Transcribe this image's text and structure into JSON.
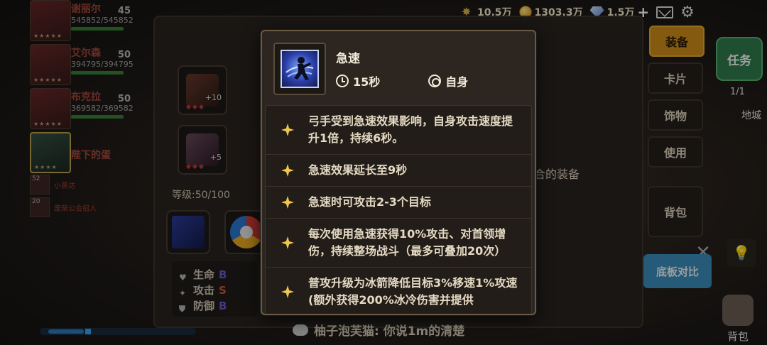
{
  "topbar": {
    "wheat_amount": "10.5万",
    "gold_amount": "1303.3万",
    "diamond_amount": "1.5万",
    "plus": "+"
  },
  "party": [
    {
      "level": "45",
      "name": "谢丽尔",
      "hp": "545852/545852"
    },
    {
      "level": "50",
      "name": "艾尔森",
      "hp": "394795/394795"
    },
    {
      "level": "50",
      "name": "布克拉",
      "hp": "369582/369582"
    },
    {
      "level": "",
      "name": "陛下的蛋",
      "hp": ""
    }
  ],
  "party_small": [
    {
      "level": "52",
      "name": "小黑达"
    },
    {
      "level": "20",
      "name": "废柴公会招人"
    }
  ],
  "equip_panel": {
    "slot1_plus": "+10",
    "slot2_plus": "+5",
    "level_text": "等级:50/100",
    "unequipped_text": "合的装备",
    "stats": [
      {
        "label": "生命",
        "grade": "B"
      },
      {
        "label": "攻击",
        "grade": "S"
      },
      {
        "label": "防御",
        "grade": "B"
      }
    ]
  },
  "side_tabs": {
    "equipment": "装备",
    "cards": "卡片",
    "accessories": "饰物",
    "use": "使用",
    "bag": "背包"
  },
  "compare_button": "底板对比",
  "task": {
    "label": "任务",
    "count": "1/1"
  },
  "region": "地城",
  "backpack": "背包",
  "chat_text": "柚子泡芙猫: 你说1m的清楚",
  "tooltip": {
    "skill_name": "急速",
    "duration": "15秒",
    "target": "自身",
    "effects": [
      "弓手受到急速效果影响，自身攻击速度提升1倍，持续6秒。",
      "急速效果延长至9秒",
      "急速时可攻击2-3个目标",
      "每次使用急速获得10%攻击、对首领增伤，持续整场战斗（最多可叠加20次）",
      "普攻升级为冰箭降低目标3%移速1%攻速(额外获得200%冰冷伤害并提供"
    ]
  }
}
